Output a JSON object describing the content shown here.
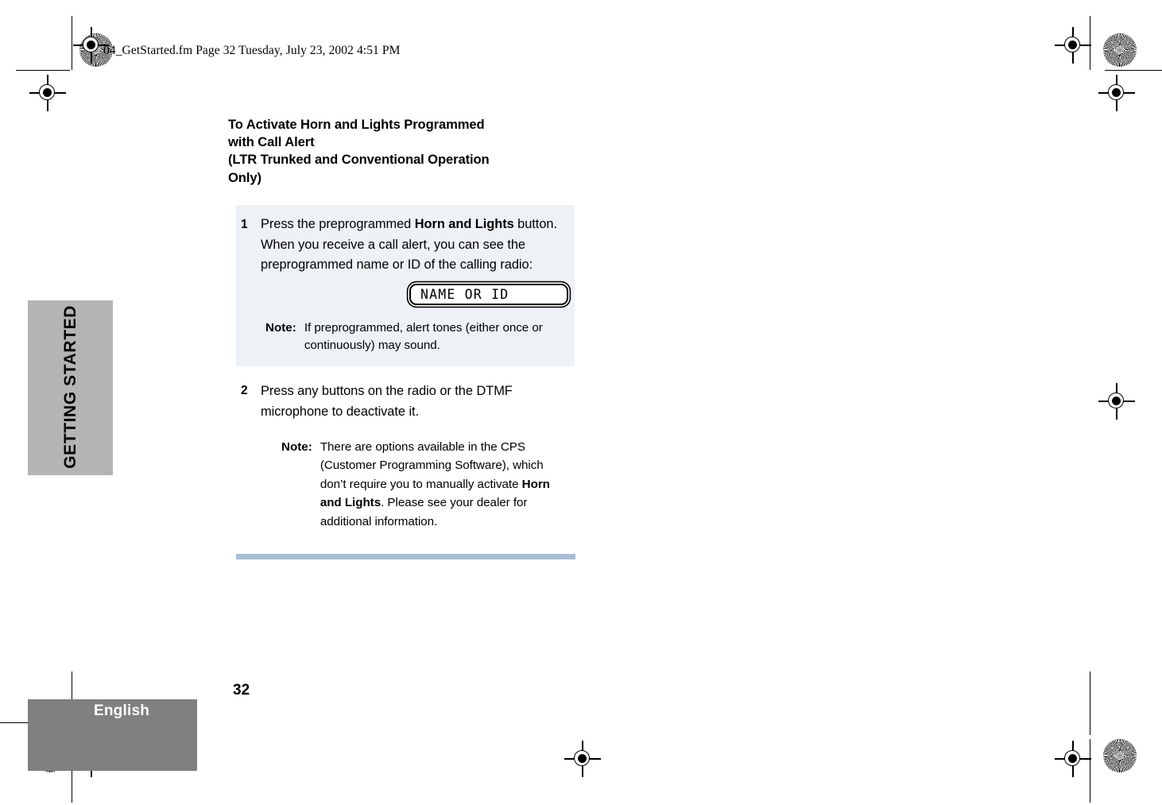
{
  "page": {
    "file_stamp": "04_GetStarted.fm  Page 32  Tuesday, July 23, 2002  4:51 PM",
    "page_number": "32",
    "language": "English",
    "section_tab": "GETTING STARTED",
    "rule_color": "#a9bdd4",
    "tab_color": "#b4b4b4",
    "footer_color": "#808080",
    "step_block_color": "#eef2f6"
  },
  "heading": {
    "line1": "To Activate Horn and Lights Programmed",
    "line2": "with Call Alert",
    "line3": "(LTR Trunked and Conventional Operation",
    "line4": "Only)"
  },
  "steps": [
    {
      "number": "1",
      "text_parts": [
        {
          "text": "Press the preprogrammed ",
          "bold": false
        },
        {
          "text": "Horn and Lights",
          "bold": true
        },
        {
          "text": " button. When you receive a call alert, you can see the preprogrammed name or ID of the calling radio:",
          "bold": false
        }
      ],
      "display": {
        "label": "NAME OR ID"
      },
      "note": {
        "label": "Note:",
        "text_parts": [
          {
            "text": "If preprogrammed, alert tones (either once or continuously) may sound.",
            "bold": false
          }
        ]
      }
    },
    {
      "number": "2",
      "text_parts": [
        {
          "text": "Press any buttons on the radio or the DTMF microphone to deactivate it.",
          "bold": false
        }
      ],
      "note": {
        "label": "Note:",
        "text_parts": [
          {
            "text": "There are options available in the CPS (Customer Programming Software), which don’t require you to manually activate ",
            "bold": false
          },
          {
            "text": "Horn and Lights",
            "bold": true
          },
          {
            "text": ". Please see your dealer for additional information.",
            "bold": false
          }
        ]
      }
    }
  ]
}
